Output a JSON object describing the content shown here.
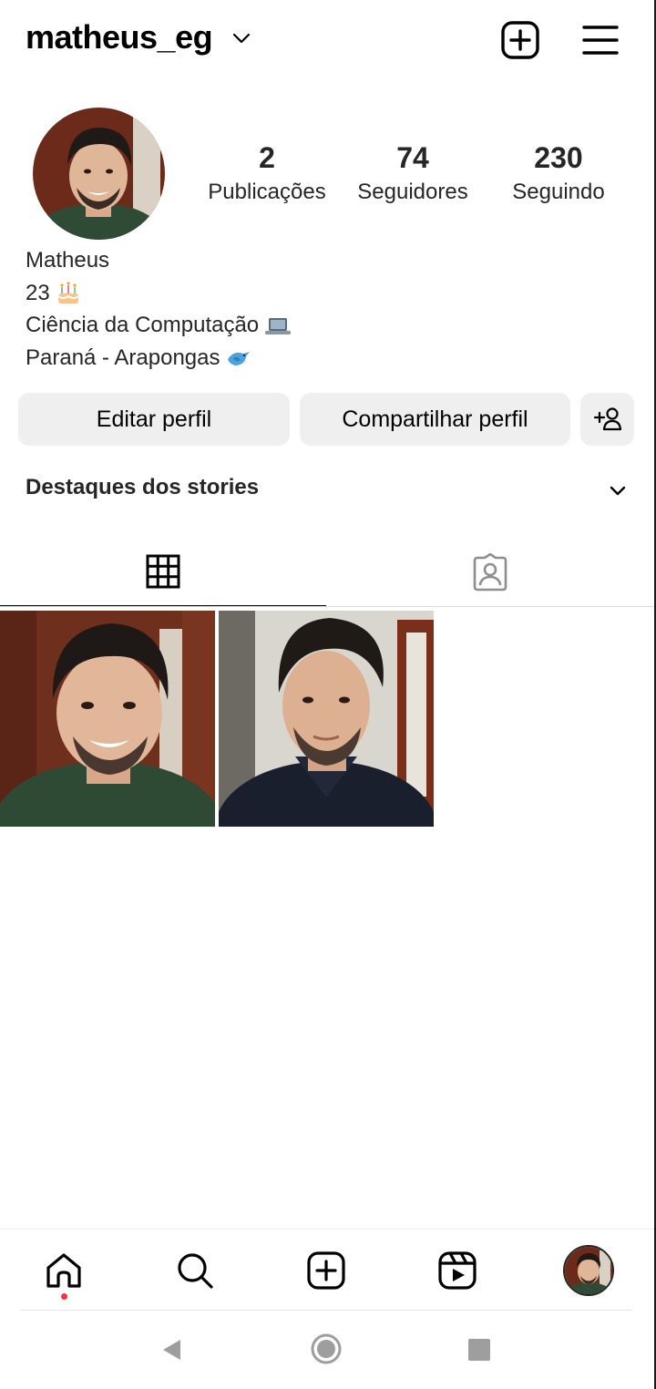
{
  "header": {
    "username": "matheus_eg",
    "icons": [
      "chevron-down-icon",
      "new-post-icon",
      "menu-icon"
    ]
  },
  "profile": {
    "stats": [
      {
        "value": "2",
        "label": "Publicações"
      },
      {
        "value": "74",
        "label": "Seguidores"
      },
      {
        "value": "230",
        "label": "Seguindo"
      }
    ],
    "bio": {
      "name": "Matheus",
      "line1": "23",
      "line2": "Ciência da Computação",
      "line3": "Paraná - Arapongas"
    }
  },
  "buttons": {
    "edit": "Editar perfil",
    "share": "Compartilhar perfil"
  },
  "highlights": {
    "title": "Destaques dos stories"
  },
  "tabs": [
    "grid-icon",
    "tagged-icon"
  ],
  "nav": [
    "home-icon",
    "search-icon",
    "create-icon",
    "reels-icon",
    "profile-avatar"
  ],
  "colors": {
    "button_bg": "#efefef",
    "notification_dot": "#ff3040",
    "text": "#262626"
  }
}
